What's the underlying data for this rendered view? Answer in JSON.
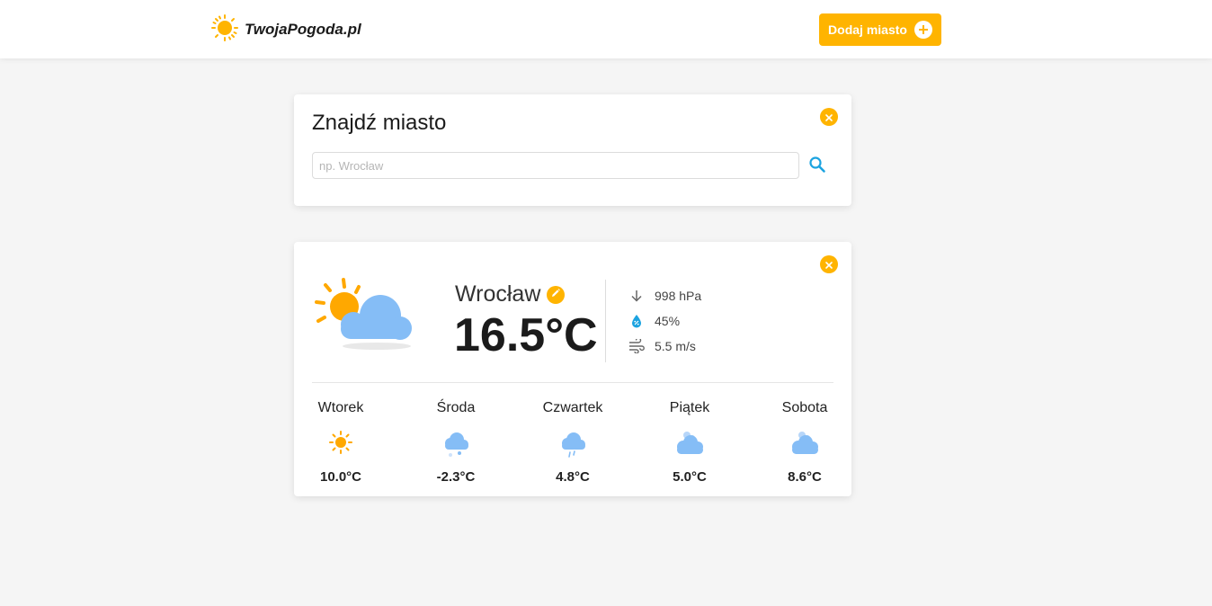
{
  "header": {
    "logo_text": "TwojaPogoda.pl",
    "logo_icon": "sun-icon",
    "add_city_label": "Dodaj miasto"
  },
  "search": {
    "title": "Znajdź miasto",
    "placeholder": "np. Wrocław"
  },
  "weather": {
    "city": "Wrocław",
    "temperature": "16.5°C",
    "current_icon": "partly-cloudy-icon",
    "pressure": "998 hPa",
    "humidity": "45%",
    "wind": "5.5 m/s",
    "forecast": [
      {
        "day": "Wtorek",
        "icon": "sun-icon",
        "temp": "10.0°C"
      },
      {
        "day": "Środa",
        "icon": "snow-icon",
        "temp": "-2.3°C"
      },
      {
        "day": "Czwartek",
        "icon": "rain-icon",
        "temp": "4.8°C"
      },
      {
        "day": "Piątek",
        "icon": "cloud-icon",
        "temp": "5.0°C"
      },
      {
        "day": "Sobota",
        "icon": "cloud-icon",
        "temp": "8.6°C"
      }
    ]
  },
  "colors": {
    "accent": "#ffb400",
    "sun": "#ffa800",
    "cloud": "#7fb8f5",
    "search_icon": "#1ca3e0",
    "humidity_icon": "#1ca3e0"
  }
}
